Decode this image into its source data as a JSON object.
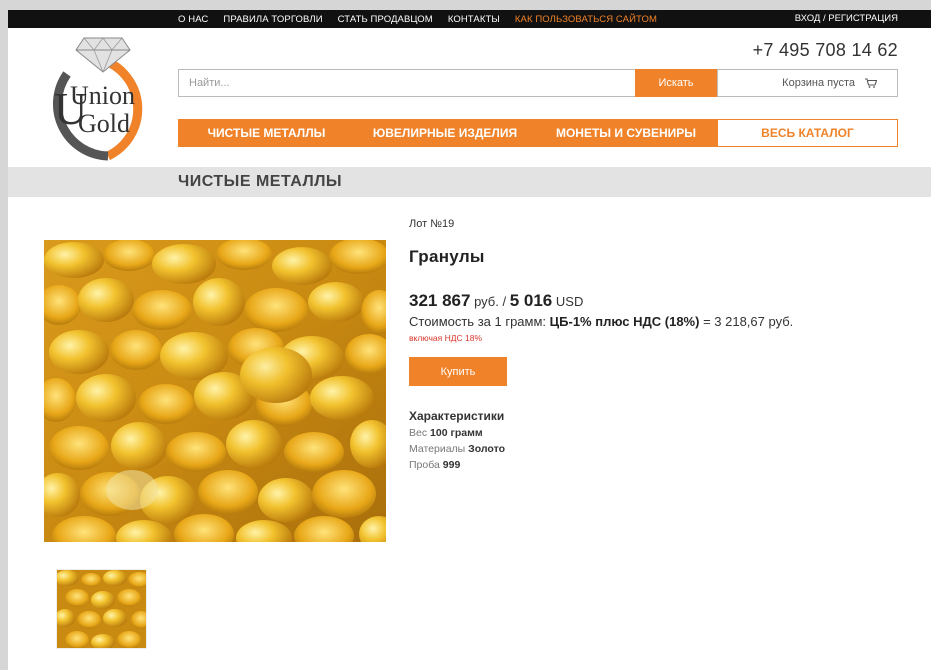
{
  "topnav": {
    "items": [
      {
        "label": "О НАС"
      },
      {
        "label": "ПРАВИЛА ТОРГОВЛИ"
      },
      {
        "label": "СТАТЬ ПРОДАВЦОМ"
      },
      {
        "label": "КОНТАКТЫ"
      },
      {
        "label": "КАК ПОЛЬЗОВАТЬСЯ САЙТОМ",
        "accent": true
      }
    ],
    "login": "ВХОД / РЕГИСТРАЦИЯ"
  },
  "logo": {
    "line1": "Union",
    "line2": "Gold",
    "initial": "U"
  },
  "header": {
    "phone": "+7 495 708 14 62"
  },
  "search": {
    "placeholder": "Найти...",
    "button": "Искать"
  },
  "cart": {
    "label": "Корзина пуста",
    "icon": "cart-icon"
  },
  "categories": [
    {
      "label": "ЧИСТЫЕ МЕТАЛЛЫ"
    },
    {
      "label": "ЮВЕЛИРНЫЕ ИЗДЕЛИЯ"
    },
    {
      "label": "МОНЕТЫ И СУВЕНИРЫ"
    },
    {
      "label": "ВЕСЬ КАТАЛОГ"
    }
  ],
  "section": {
    "title": "ЧИСТЫЕ МЕТАЛЛЫ"
  },
  "product": {
    "lot": "Лот №19",
    "title": "Гранулы",
    "price_rub": "321 867",
    "rub_unit": "руб. /",
    "price_usd": "5 016",
    "usd_unit": "USD",
    "per_gram_label": "Стоимость за 1 грамм:",
    "per_gram_formula": "ЦБ-1% плюс НДС (18%)",
    "per_gram_value": "= 3 218,67 руб.",
    "vat_note": "включая НДС 18%",
    "buy_label": "Купить",
    "characteristics_title": "Характеристики",
    "characteristics": [
      {
        "name": "Вес",
        "value": "100 грамм"
      },
      {
        "name": "Материалы",
        "value": "Золото"
      },
      {
        "name": "Проба",
        "value": "999"
      }
    ]
  },
  "colors": {
    "accent": "#f0832a",
    "gold": "#e8b023",
    "dark": "#111111"
  }
}
